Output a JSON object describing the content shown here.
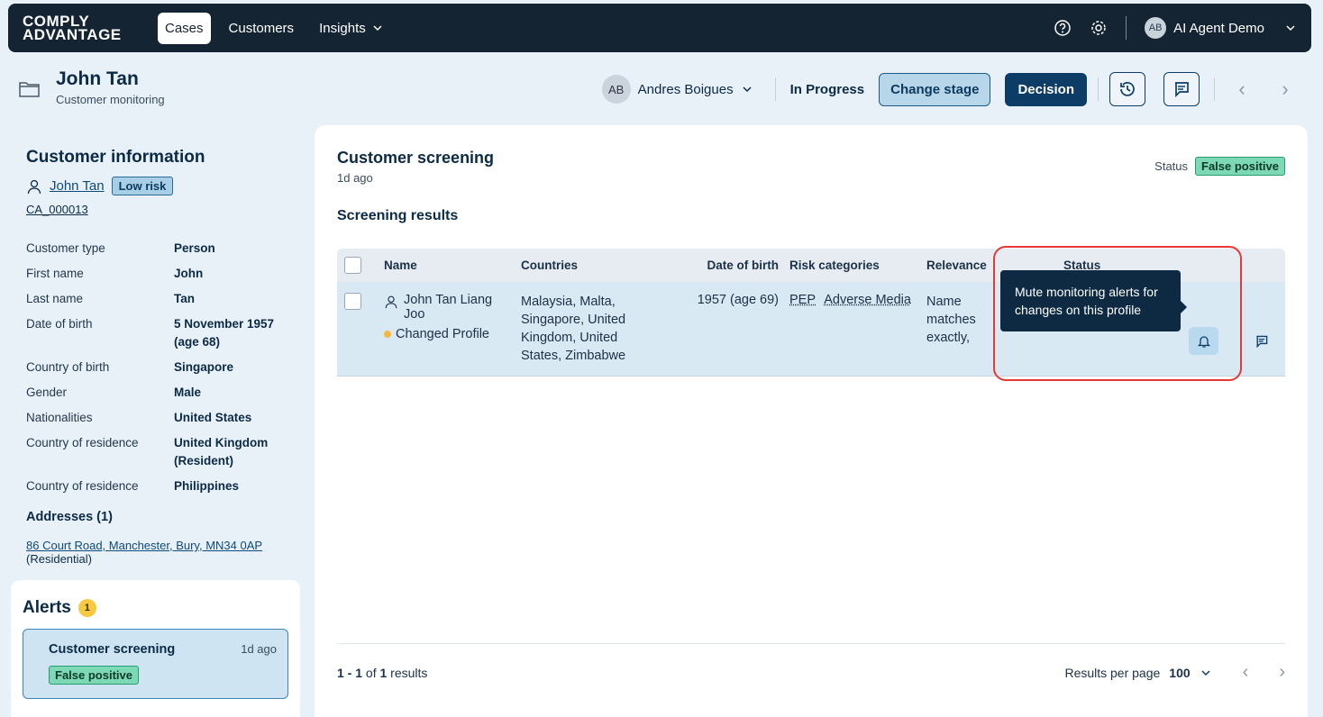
{
  "topbar": {
    "logo_line1": "COMPLY",
    "logo_line2": "ADVANTAGE",
    "nav": [
      {
        "label": "Cases"
      },
      {
        "label": "Customers"
      },
      {
        "label": "Insights"
      }
    ],
    "user_initials": "AB",
    "user_name": "AI Agent Demo"
  },
  "case": {
    "title": "John Tan",
    "subtitle": "Customer monitoring",
    "assignee_initials": "AB",
    "assignee": "Andres Boigues",
    "stage": "In Progress",
    "change_stage_label": "Change stage",
    "decision_label": "Decision"
  },
  "customer": {
    "section_title": "Customer information",
    "name": "John Tan",
    "risk": "Low risk",
    "id": "CA_000013",
    "fields": [
      {
        "k": "Customer type",
        "v": "Person"
      },
      {
        "k": "First name",
        "v": "John"
      },
      {
        "k": "Last name",
        "v": "Tan"
      },
      {
        "k": "Date of birth",
        "v": "5 November 1957 (age 68)"
      },
      {
        "k": "Country of birth",
        "v": "Singapore"
      },
      {
        "k": "Gender",
        "v": "Male"
      },
      {
        "k": "Nationalities",
        "v": "United States"
      },
      {
        "k": "Country of residence",
        "v": "United Kingdom (Resident)"
      },
      {
        "k": "Country of residence",
        "v": "Philippines"
      }
    ],
    "addresses_title": "Addresses (1)",
    "address": "86 Court Road, Manchester, Bury, MN34 0AP",
    "address_type": "(Residential)"
  },
  "alerts": {
    "title": "Alerts",
    "count": "1",
    "card": {
      "name": "Customer screening",
      "time": "1d ago",
      "status": "False positive"
    }
  },
  "screening": {
    "title": "Customer screening",
    "time": "1d ago",
    "status_label": "Status",
    "status": "False positive",
    "results_title": "Screening results",
    "columns": [
      "Name",
      "Countries",
      "Date of birth",
      "Risk categories",
      "Relevance",
      "Status"
    ],
    "row": {
      "name": "John Tan Liang Joo",
      "change": "Changed Profile",
      "countries": "Malaysia, Malta, Singapore, United Kingdom, United States, Zimbabwe",
      "dob": "1957 (age 69)",
      "risk1": "PEP",
      "risk2": "Adverse Media",
      "relevance": "Name matches exactly, Matched birth year fi"
    },
    "tooltip": "Mute monitoring alerts for changes on this profile",
    "footer_range": "1 - 1",
    "footer_of": "of",
    "footer_total": "1",
    "footer_results": "results",
    "per_page_label": "Results per page",
    "per_page": "100"
  }
}
